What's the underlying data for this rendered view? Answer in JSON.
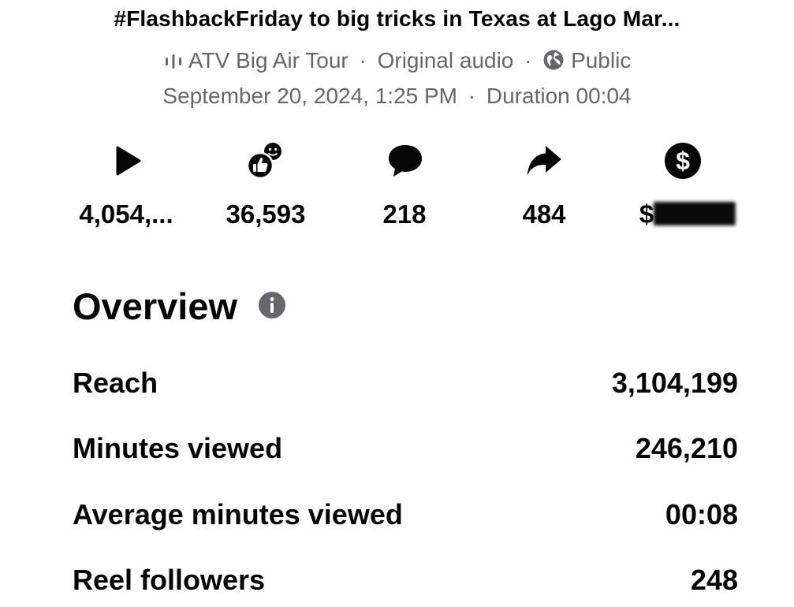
{
  "post": {
    "title": "#FlashbackFriday to big tricks in Texas at Lago Mar...",
    "audio_owner": "ATV Big Air Tour",
    "audio_type": "Original audio",
    "privacy": "Public",
    "datetime": "September 20, 2024, 1:25 PM",
    "duration_label": "Duration 00:04",
    "separator": "·"
  },
  "stats": [
    {
      "icon": "play-icon",
      "value": "4,054,..."
    },
    {
      "icon": "reactions-icon",
      "value": "36,593"
    },
    {
      "icon": "comment-icon",
      "value": "218"
    },
    {
      "icon": "share-icon",
      "value": "484"
    },
    {
      "icon": "dollar-icon",
      "value": "$",
      "redacted": true
    }
  ],
  "overview": {
    "heading": "Overview",
    "info_icon": "info-icon",
    "rows": [
      {
        "label": "Reach",
        "value": "3,104,199"
      },
      {
        "label": "Minutes viewed",
        "value": "246,210"
      },
      {
        "label": "Average minutes viewed",
        "value": "00:08"
      },
      {
        "label": "Reel followers",
        "value": "248"
      }
    ]
  },
  "colors": {
    "text": "#050505",
    "secondary": "#65676b",
    "icon": "#050505"
  }
}
